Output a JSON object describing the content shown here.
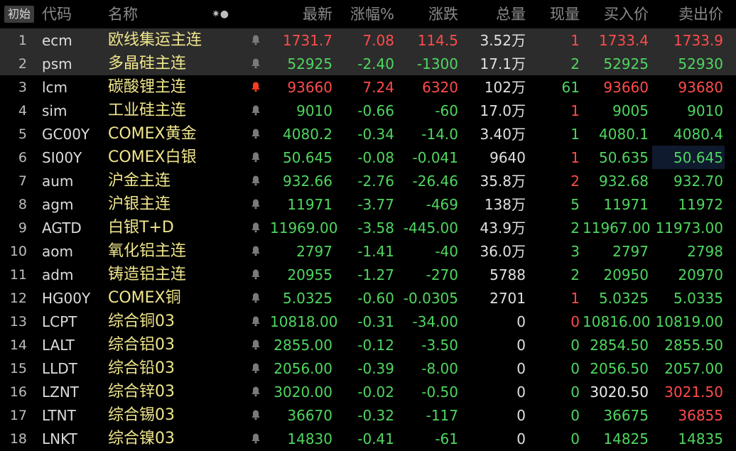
{
  "header": {
    "init_button": "初始",
    "col_code": "代码",
    "col_name": "名称",
    "col_symbol": "✷●",
    "col_last": "最新",
    "col_pct": "涨幅%",
    "col_change": "涨跌",
    "col_total_vol": "总量",
    "col_cur_vol": "现量",
    "col_bid": "买入价",
    "col_ask": "卖出价"
  },
  "colors": {
    "up": "#ff4b4b",
    "down": "#4fd660",
    "flat": "#ececec",
    "name": "#f0e68c",
    "bell_active": "#ff3b1f",
    "bell_idle": "#7a7a7a"
  },
  "rows": [
    {
      "no": "1",
      "code": "ecm",
      "name": "欧线集运主连",
      "bell": "idle",
      "last": "1731.7",
      "pct": "7.08",
      "chg": "114.5",
      "dir": "up",
      "vol": "3.52万",
      "cur": "1",
      "cur_dir": "up",
      "bid": "1733.4",
      "bid_dir": "up",
      "ask": "1733.9",
      "ask_dir": "up",
      "selected": true
    },
    {
      "no": "2",
      "code": "psm",
      "name": "多晶硅主连",
      "bell": "idle",
      "last": "52925",
      "pct": "-2.40",
      "chg": "-1300",
      "dir": "dn",
      "vol": "17.1万",
      "cur": "2",
      "cur_dir": "dn",
      "bid": "52925",
      "bid_dir": "dn",
      "ask": "52930",
      "ask_dir": "dn",
      "selected": true
    },
    {
      "no": "3",
      "code": "lcm",
      "name": "碳酸锂主连",
      "bell": "active",
      "last": "93660",
      "pct": "7.24",
      "chg": "6320",
      "dir": "up",
      "vol": "102万",
      "cur": "61",
      "cur_dir": "dn",
      "bid": "93660",
      "bid_dir": "up",
      "ask": "93680",
      "ask_dir": "up"
    },
    {
      "no": "4",
      "code": "sim",
      "name": "工业硅主连",
      "bell": "idle",
      "last": "9010",
      "pct": "-0.66",
      "chg": "-60",
      "dir": "dn",
      "vol": "17.0万",
      "cur": "1",
      "cur_dir": "up",
      "bid": "9005",
      "bid_dir": "dn",
      "ask": "9010",
      "ask_dir": "dn"
    },
    {
      "no": "5",
      "code": "GC00Y",
      "name": "COMEX黄金",
      "bell": "idle",
      "last": "4080.2",
      "pct": "-0.34",
      "chg": "-14.0",
      "dir": "dn",
      "vol": "3.40万",
      "cur": "1",
      "cur_dir": "dn",
      "bid": "4080.1",
      "bid_dir": "dn",
      "ask": "4080.4",
      "ask_dir": "dn"
    },
    {
      "no": "6",
      "code": "SI00Y",
      "name": "COMEX白银",
      "bell": "idle",
      "last": "50.645",
      "pct": "-0.08",
      "chg": "-0.041",
      "dir": "dn",
      "vol": "9640",
      "cur": "1",
      "cur_dir": "up",
      "bid": "50.635",
      "bid_dir": "dn",
      "ask": "50.645",
      "ask_dir": "dn",
      "ask_hl": true
    },
    {
      "no": "7",
      "code": "aum",
      "name": "沪金主连",
      "bell": "idle",
      "last": "932.66",
      "pct": "-2.76",
      "chg": "-26.46",
      "dir": "dn",
      "vol": "35.8万",
      "cur": "2",
      "cur_dir": "up",
      "bid": "932.68",
      "bid_dir": "dn",
      "ask": "932.70",
      "ask_dir": "dn"
    },
    {
      "no": "8",
      "code": "agm",
      "name": "沪银主连",
      "bell": "idle",
      "last": "11971",
      "pct": "-3.77",
      "chg": "-469",
      "dir": "dn",
      "vol": "138万",
      "cur": "5",
      "cur_dir": "dn",
      "bid": "11971",
      "bid_dir": "dn",
      "ask": "11972",
      "ask_dir": "dn"
    },
    {
      "no": "9",
      "code": "AGTD",
      "name": "白银T+D",
      "bell": "idle",
      "last": "11969.00",
      "pct": "-3.58",
      "chg": "-445.00",
      "dir": "dn",
      "vol": "43.9万",
      "cur": "2",
      "cur_dir": "dn",
      "bid": "11967.00",
      "bid_dir": "dn",
      "ask": "11973.00",
      "ask_dir": "dn"
    },
    {
      "no": "10",
      "code": "aom",
      "name": "氧化铝主连",
      "bell": "idle",
      "last": "2797",
      "pct": "-1.41",
      "chg": "-40",
      "dir": "dn",
      "vol": "36.0万",
      "cur": "3",
      "cur_dir": "dn",
      "bid": "2797",
      "bid_dir": "dn",
      "ask": "2798",
      "ask_dir": "dn"
    },
    {
      "no": "11",
      "code": "adm",
      "name": "铸造铝主连",
      "bell": "idle",
      "last": "20955",
      "pct": "-1.27",
      "chg": "-270",
      "dir": "dn",
      "vol": "5788",
      "cur": "2",
      "cur_dir": "dn",
      "bid": "20950",
      "bid_dir": "dn",
      "ask": "20970",
      "ask_dir": "dn"
    },
    {
      "no": "12",
      "code": "HG00Y",
      "name": "COMEX铜",
      "bell": "idle",
      "last": "5.0325",
      "pct": "-0.60",
      "chg": "-0.0305",
      "dir": "dn",
      "vol": "2701",
      "cur": "1",
      "cur_dir": "up",
      "bid": "5.0325",
      "bid_dir": "dn",
      "ask": "5.0335",
      "ask_dir": "dn"
    },
    {
      "no": "13",
      "code": "LCPT",
      "name": "综合铜03",
      "bell": "idle",
      "last": "10818.00",
      "pct": "-0.31",
      "chg": "-34.00",
      "dir": "dn",
      "vol": "0",
      "cur": "0",
      "cur_dir": "up",
      "bid": "10816.00",
      "bid_dir": "dn",
      "ask": "10819.00",
      "ask_dir": "dn"
    },
    {
      "no": "14",
      "code": "LALT",
      "name": "综合铝03",
      "bell": "idle",
      "last": "2855.00",
      "pct": "-0.12",
      "chg": "-3.50",
      "dir": "dn",
      "vol": "0",
      "cur": "0",
      "cur_dir": "dn",
      "bid": "2854.50",
      "bid_dir": "dn",
      "ask": "2855.50",
      "ask_dir": "dn"
    },
    {
      "no": "15",
      "code": "LLDT",
      "name": "综合铅03",
      "bell": "idle",
      "last": "2056.00",
      "pct": "-0.39",
      "chg": "-8.00",
      "dir": "dn",
      "vol": "0",
      "cur": "0",
      "cur_dir": "dn",
      "bid": "2056.50",
      "bid_dir": "dn",
      "ask": "2057.00",
      "ask_dir": "dn"
    },
    {
      "no": "16",
      "code": "LZNT",
      "name": "综合锌03",
      "bell": "idle",
      "last": "3020.00",
      "pct": "-0.02",
      "chg": "-0.50",
      "dir": "dn",
      "vol": "0",
      "cur": "0",
      "cur_dir": "dn",
      "bid": "3020.50",
      "bid_dir": "eq",
      "ask": "3021.50",
      "ask_dir": "up"
    },
    {
      "no": "17",
      "code": "LTNT",
      "name": "综合锡03",
      "bell": "idle",
      "last": "36670",
      "pct": "-0.32",
      "chg": "-117",
      "dir": "dn",
      "vol": "0",
      "cur": "0",
      "cur_dir": "dn",
      "bid": "36675",
      "bid_dir": "dn",
      "ask": "36855",
      "ask_dir": "up"
    },
    {
      "no": "18",
      "code": "LNKT",
      "name": "综合镍03",
      "bell": "idle",
      "last": "14830",
      "pct": "-0.41",
      "chg": "-61",
      "dir": "dn",
      "vol": "0",
      "cur": "0",
      "cur_dir": "dn",
      "bid": "14825",
      "bid_dir": "dn",
      "ask": "14835",
      "ask_dir": "dn"
    }
  ]
}
